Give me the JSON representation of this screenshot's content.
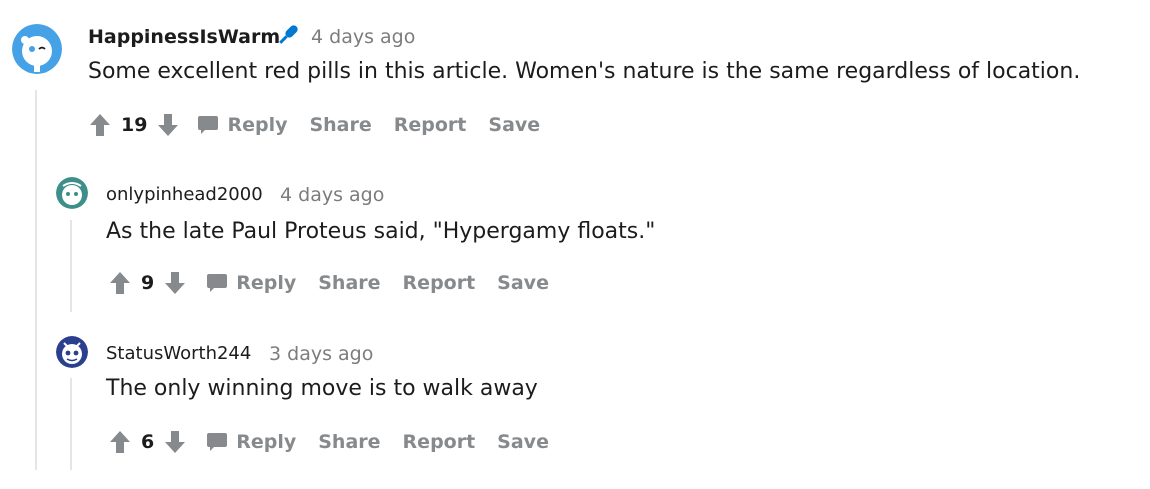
{
  "colors": {
    "muted": "#878a8c",
    "text": "#1c1c1c",
    "timestamp": "#7c7c7c",
    "thread_line": "#e5e5e5",
    "mic_accent": "#0079d3"
  },
  "comments": [
    {
      "username": "HappinessIsWarm",
      "timestamp": "4 days ago",
      "body": "Some excellent red pills in this article. Women's nature is the same regardless of location.",
      "score": "19",
      "avatar_icon": "snoo-avatar-blue-icon",
      "flair_icon": "microphone-icon"
    },
    {
      "username": "onlypinhead2000",
      "timestamp": "4 days ago",
      "body": "As the late Paul Proteus said, \"Hypergamy floats.\"",
      "score": "9",
      "avatar_icon": "snoo-avatar-teal-icon"
    },
    {
      "username": "StatusWorth244",
      "timestamp": "3 days ago",
      "body": "The only winning move is to walk away",
      "score": "6",
      "avatar_icon": "snoo-avatar-navy-icon"
    }
  ],
  "actions": {
    "reply": "Reply",
    "share": "Share",
    "report": "Report",
    "save": "Save"
  }
}
